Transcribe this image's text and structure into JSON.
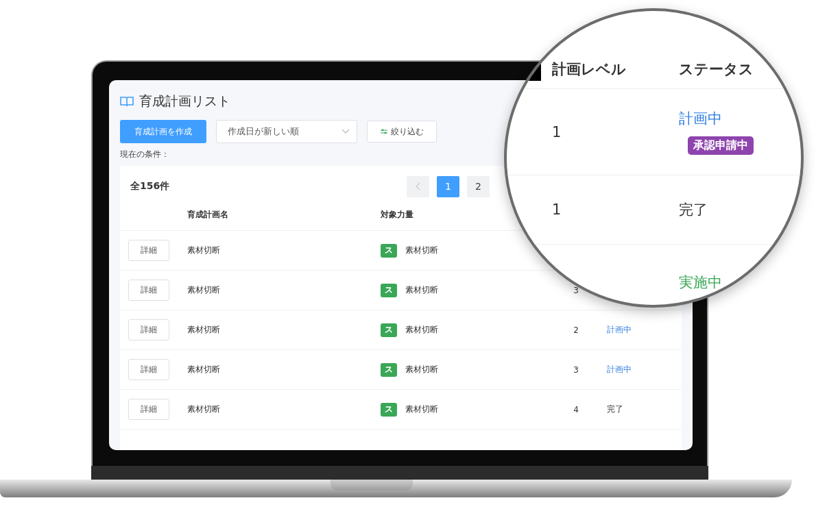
{
  "page": {
    "title": "育成計画リスト",
    "create_button": "育成計画を作成",
    "sort_select": "作成日が新しい順",
    "filter_button": "絞り込む",
    "conditions_label": "現在の条件："
  },
  "list": {
    "total": "全156件",
    "pages": [
      {
        "label": "1",
        "selected": true
      },
      {
        "label": "2",
        "selected": false
      }
    ]
  },
  "table": {
    "columns": [
      "育成計画名",
      "対象力量"
    ],
    "rows": [
      {
        "action": "詳細",
        "name": "素材切断",
        "skill_tag": "ス",
        "skill": "素材切断"
      },
      {
        "action": "詳細",
        "name": "素材切断",
        "skill_tag": "ス",
        "skill": "素材切断",
        "level": "3"
      },
      {
        "action": "詳細",
        "name": "素材切断",
        "skill_tag": "ス",
        "skill": "素材切断",
        "level": "2",
        "status": {
          "text": "計画中",
          "kind": "planning"
        }
      },
      {
        "action": "詳細",
        "name": "素材切断",
        "skill_tag": "ス",
        "skill": "素材切断",
        "level": "3",
        "status": {
          "text": "計画中",
          "kind": "planning"
        }
      },
      {
        "action": "詳細",
        "name": "素材切断",
        "skill_tag": "ス",
        "skill": "素材切断",
        "level": "4",
        "status": {
          "text": "完了",
          "kind": "done"
        }
      }
    ]
  },
  "magnifier": {
    "columns": [
      "計画レベル",
      "ステータス"
    ],
    "rows": [
      {
        "level": "1",
        "status": {
          "text": "計画中",
          "kind": "planning"
        },
        "badge": "承認申請中"
      },
      {
        "level": "1",
        "status": {
          "text": "完了",
          "kind": "done"
        }
      },
      {
        "status": {
          "text": "実施中",
          "kind": "active"
        }
      }
    ]
  }
}
